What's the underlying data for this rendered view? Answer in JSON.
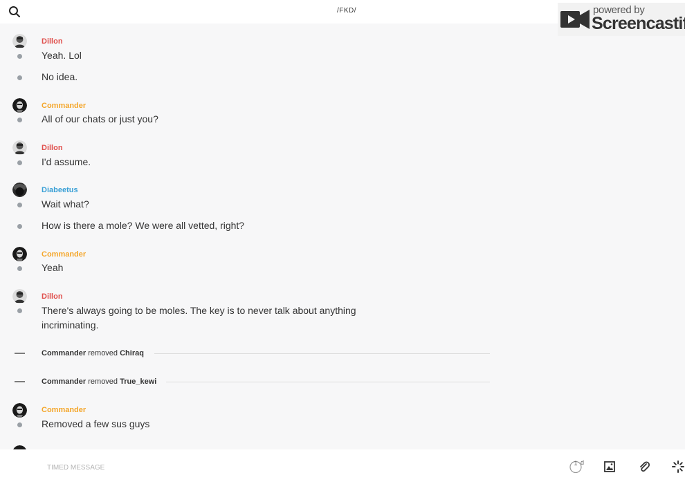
{
  "header": {
    "title": "/FKD/",
    "search_icon": "search-icon",
    "call_icon": "phone-icon",
    "info_icon": "info-icon"
  },
  "watermark": {
    "powered": "powered by",
    "name": "Screencastify"
  },
  "colors": {
    "dillon": "#e0504d",
    "commander": "#f4a62a",
    "diabeetus": "#3aa0d6",
    "dot": "#9aa0a6"
  },
  "messages": [
    {
      "sender": "Dillon",
      "lines": [
        "Yeah. Lol",
        "No idea."
      ]
    },
    {
      "sender": "Commander",
      "lines": [
        "All of our chats or just you?"
      ]
    },
    {
      "sender": "Dillon",
      "lines": [
        "I'd assume."
      ]
    },
    {
      "sender": "Diabeetus",
      "lines": [
        "Wait what?",
        "How is there a mole? We were all vetted, right?"
      ]
    },
    {
      "sender": "Commander",
      "lines": [
        "Yeah"
      ]
    },
    {
      "sender": "Dillon",
      "lines": [
        "There's always going to be moles. The key is to never talk about anything incriminating."
      ]
    }
  ],
  "system_events": [
    {
      "actor": "Commander",
      "action": "removed",
      "target": "Chiraq"
    },
    {
      "actor": "Commander",
      "action": "removed",
      "target": "True_kewi"
    }
  ],
  "last_message": {
    "sender": "Commander",
    "lines": [
      "Removed a few sus guys"
    ]
  },
  "composer": {
    "placeholder": "TIMED MESSAGE",
    "value": "",
    "timer_value": "1",
    "timer_unit": "d",
    "icons": [
      "timer-icon",
      "image-icon",
      "paperclip-icon",
      "spinner-icon"
    ]
  }
}
